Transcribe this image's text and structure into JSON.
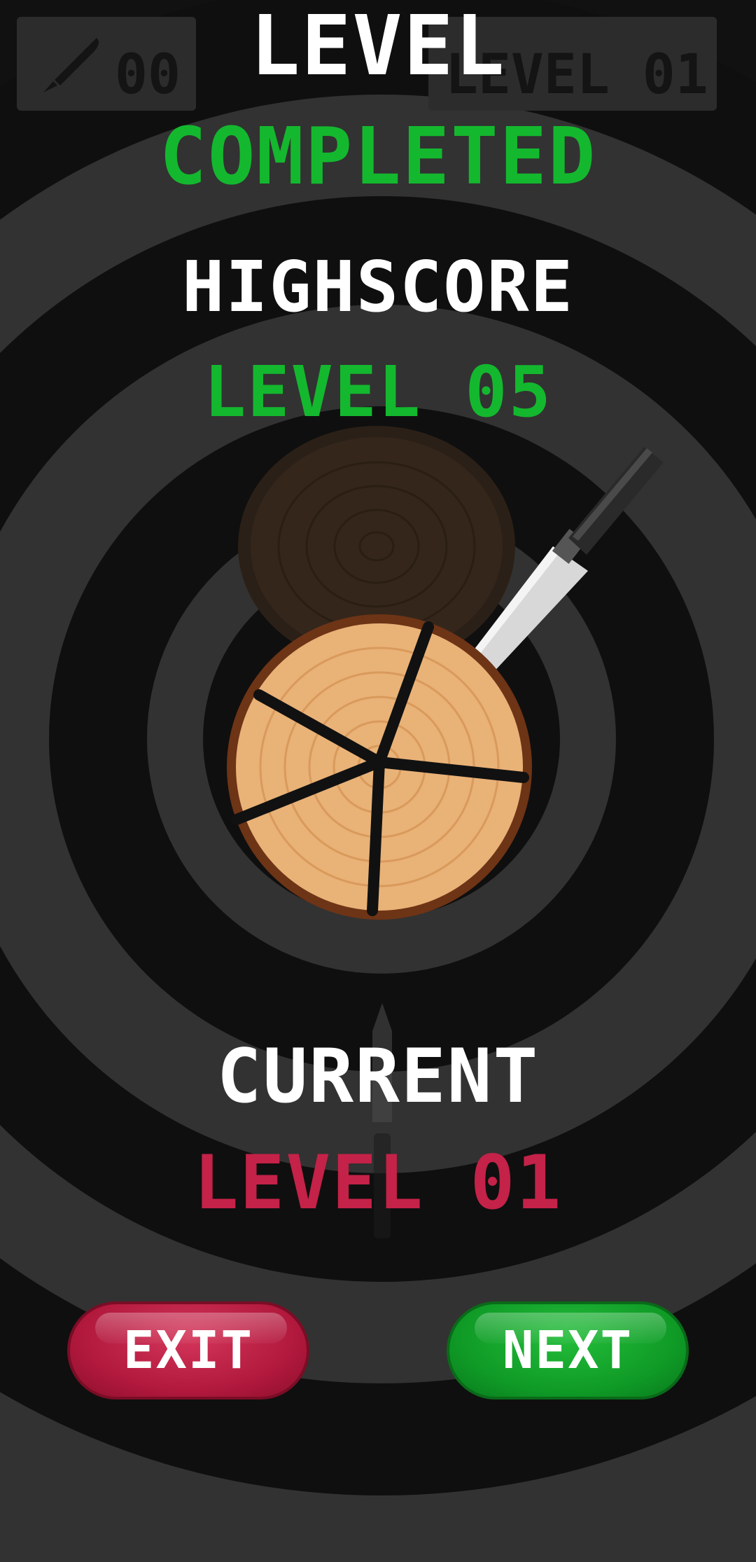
{
  "hud": {
    "knife_count": "00",
    "level_label": "LEVEL 01"
  },
  "result": {
    "title_line1": "LEVEL",
    "title_line2": "COMPLETED",
    "highscore_label": "HIGHSCORE",
    "highscore_value": "LEVEL 05",
    "current_label": "CURRENT",
    "current_value": "LEVEL 01"
  },
  "buttons": {
    "exit_label": "EXIT",
    "next_label": "NEXT"
  },
  "colors": {
    "background": "#111111",
    "ring": "#333333",
    "green": "#14b82e",
    "red": "#c42248",
    "white": "#ffffff",
    "wood": "#e9b277"
  },
  "icons": [
    "knife-icon",
    "log-icon",
    "chef-knife",
    "thrown-knife"
  ]
}
